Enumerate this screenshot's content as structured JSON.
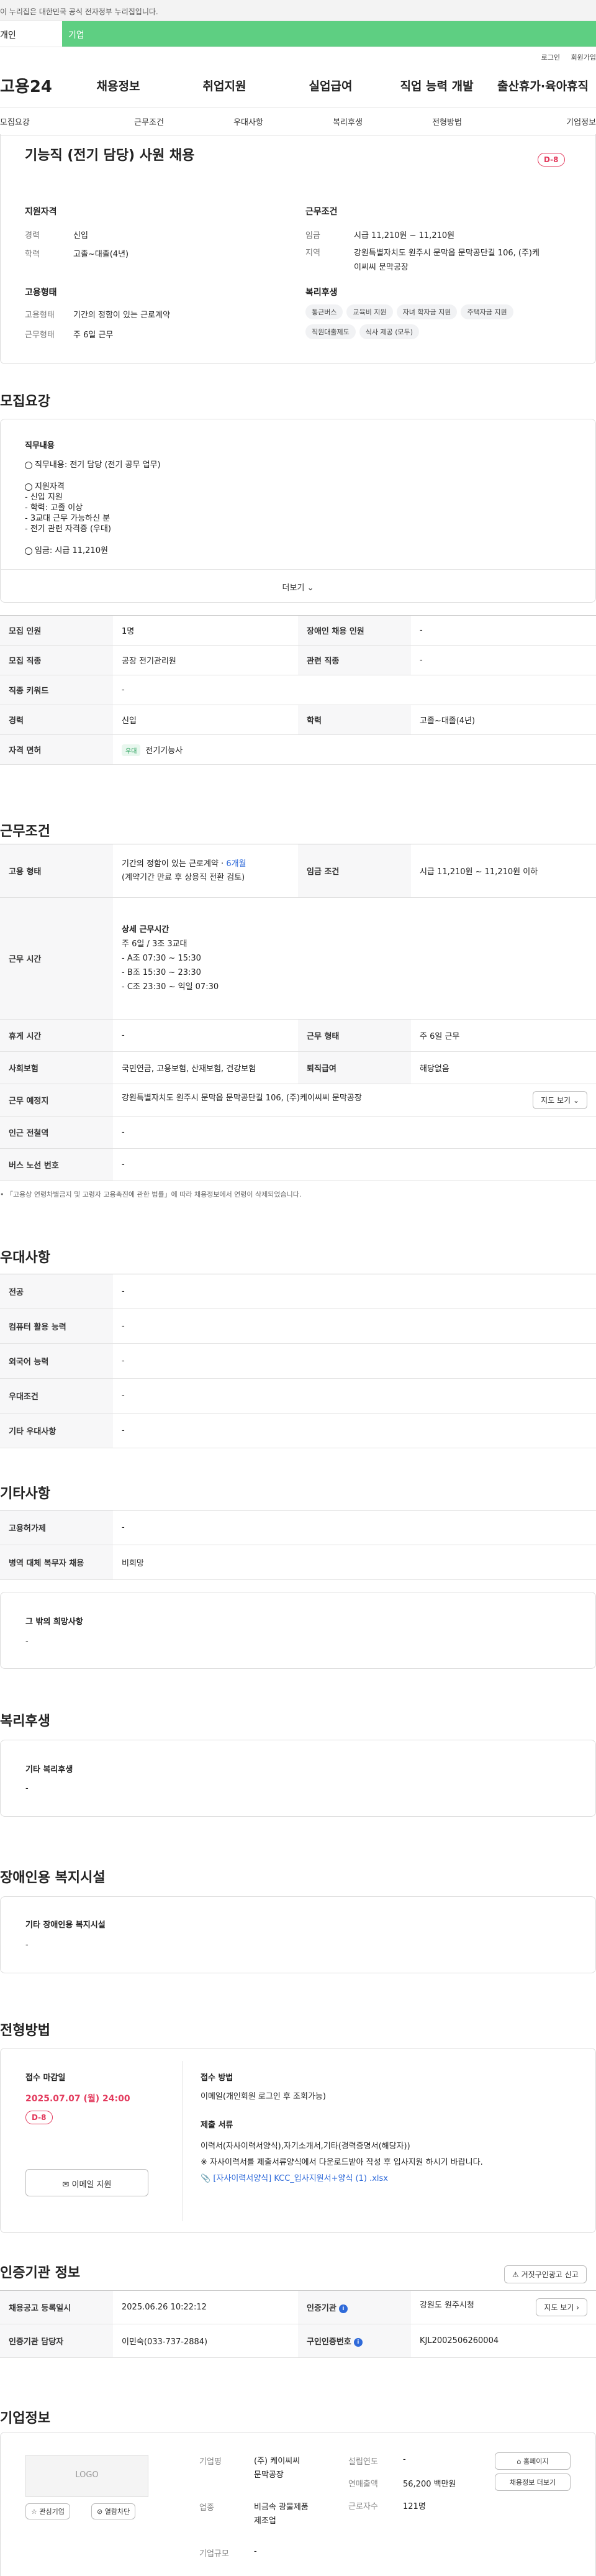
{
  "gov_notice": "이 누리집은 대한민국 공식 전자정부 누리집입니다.",
  "top_tabs": {
    "personal": "개인",
    "company": "기업"
  },
  "utility": {
    "login": "로그인",
    "signup": "회원가입"
  },
  "logo": "고용24",
  "main_nav": [
    "채용정보",
    "취업지원",
    "실업급여",
    "직업 능력 개발",
    "출산휴가·육아휴직"
  ],
  "sub_nav": [
    "모집요강",
    "근무조건",
    "우대사항",
    "복리후생",
    "전형방법",
    "기업정보"
  ],
  "header": {
    "title": "기능직 (전기 담당) 사원 채용",
    "dday": "D-8",
    "qualification": {
      "label": "지원자격",
      "career_k": "경력",
      "career_v": "신입",
      "edu_k": "학력",
      "edu_v": "고졸~대졸(4년)"
    },
    "conditions": {
      "label": "근무조건",
      "wage_k": "임금",
      "wage_v": "시급 11,210원 ~ 11,210원",
      "loc_k": "지역",
      "loc_v1": "강원특별자치도 원주시 문막읍 문막공단길 106, (주)케",
      "loc_v2": "이씨씨 문막공장"
    },
    "employment": {
      "label": "고용형태",
      "type_k": "고용형태",
      "type_v": "기간의 정함이 있는 근로계약",
      "work_k": "근무형태",
      "work_v": "주 6일 근무"
    },
    "welfare": {
      "label": "복리후생",
      "chips": [
        "통근버스",
        "교육비 지원",
        "자녀 학자금 지원",
        "주택자금 지원",
        "직원대출제도",
        "식사 제공 (모두)"
      ]
    }
  },
  "recruit": {
    "heading": "모집요강",
    "content_label": "직무내용",
    "line1": "직무내용: 전기 담당 (전기 공무 업무)",
    "line2": "지원자격",
    "line3": "- 신입 지원",
    "line4": "- 학력: 고졸 이상",
    "line5": "- 3교대 근무 가능하신 분",
    "line6": "- 전기 관련 자격증 (우대)",
    "line7": "임금: 시급 11,210원",
    "more": "더보기",
    "table": {
      "headcount_k": "모집 인원",
      "headcount_v": "1명",
      "disabled_k": "장애인 채용 인원",
      "disabled_v": "-",
      "job_k": "모집 직종",
      "job_v": "공장 전기관리원",
      "related_k": "관련 직종",
      "related_v": "-",
      "keyword_k": "직종 키워드",
      "keyword_v": "-",
      "career_k": "경력",
      "career_v": "신입",
      "edu_k": "학력",
      "edu_v": "고졸~대졸(4년)",
      "license_k": "자격 면허",
      "license_tag": "우대",
      "license_v": "전기기능사"
    }
  },
  "work": {
    "heading": "근무조건",
    "type_k": "고용 형태",
    "type_v1": "기간의 정함이 있는 근로계약 · ",
    "type_months": "6개월",
    "type_v2": "(계약기간 만료 후 상용직 전환 검토)",
    "wage_k": "임금 조건",
    "wage_v": "시급 11,210원 ~ 11,210원 이하",
    "hours_k": "근무 시간",
    "hours_title": "상세 근무시간",
    "hours": [
      "주 6일 / 3조 3교대",
      "- A조 07:30 ~ 15:30",
      "- B조 15:30 ~ 23:30",
      "- C조 23:30 ~ 익일 07:30"
    ],
    "rest_k": "휴게 시간",
    "rest_v": "-",
    "form_k": "근무 형태",
    "form_v": "주 6일 근무",
    "insurance_k": "사회보험",
    "insurance_v": "국민연금, 고용보험, 산재보험, 건강보험",
    "retire_k": "퇴직급여",
    "retire_v": "해당없음",
    "place_k": "근무 예정지",
    "place_v": "강원특별자치도 원주시 문막읍 문막공단길 106, (주)케이씨씨 문막공장",
    "map_btn": "지도 보기",
    "subway_k": "인근 전철역",
    "subway_v": "-",
    "bus_k": "버스 노선 번호",
    "bus_v": "-",
    "note": "「고용상 연령차별금지 및 고령자 고용촉진에 관한 법률」에 따라 채용정보에서 연령이 삭제되었습니다."
  },
  "pref": {
    "heading": "우대사항",
    "rows": [
      [
        "전공",
        "-"
      ],
      [
        "컴퓨터 활용 능력",
        "-"
      ],
      [
        "외국어 능력",
        "-"
      ],
      [
        "우대조건",
        "-"
      ],
      [
        "기타 우대사항",
        "-"
      ]
    ]
  },
  "etc": {
    "heading": "기타사항",
    "rows": [
      [
        "고용허가제",
        "-"
      ],
      [
        "병역 대체 복무자 채용",
        "비희망"
      ]
    ],
    "wish_label": "그 밖의 희망사항",
    "wish_v": "-"
  },
  "welfare": {
    "heading": "복리후생",
    "label": "기타 복리후생",
    "value": "-"
  },
  "disabled": {
    "heading": "장애인용 복지시설",
    "label": "기타 장애인용 복지시설",
    "value": "-"
  },
  "selection": {
    "heading": "전형방법",
    "deadline_label": "접수 마감일",
    "deadline": "2025.07.07 (월) 24:00",
    "dday": "D-8",
    "apply_btn": "이메일 지원",
    "method_label": "접수 방법",
    "method_v": "이메일(개인회원 로그인 후 조회가능)",
    "docs_label": "제출 서류",
    "docs_v": "이력서(자사이력서양식),자기소개서,기타(경력증명서(해당자))",
    "docs_note": "※ 자사이력서를 제출서류양식에서 다운로드받아 작성 후 입사지원 하시기 바랍니다.",
    "file": "[자사이력서양식] KCC_입사지원서+양식 (1) .xlsx"
  },
  "cert": {
    "heading": "인증기관 정보",
    "report_btn": "거짓구인광고 신고",
    "reg_k": "채용공고 등록일시",
    "reg_v": "2025.06.26 10:22:12",
    "org_k": "인증기관",
    "org_v": "강원도 원주시청",
    "map_btn": "지도 보기",
    "manager_k": "인증기관 담당자",
    "manager_v": "이민숙(033-737-2884)",
    "id_k": "구인인증번호",
    "id_v": "KJL2002506260004"
  },
  "company": {
    "heading": "기업정보",
    "logo_text": "LOGO",
    "interest_btn": "관심기업",
    "block_btn": "열람차단",
    "name_k": "기업명",
    "name_v1": "(주) 케이씨씨",
    "name_v2": "문막공장",
    "industry_k": "업종",
    "industry_v1": "비금속 광물제품",
    "industry_v2": "제조업",
    "size_k": "기업규모",
    "size_v": "-",
    "founded_k": "설립연도",
    "founded_v": "-",
    "sales_k": "연매출액",
    "sales_v": "56,200 백만원",
    "staff_k": "근로자수",
    "staff_v": "121명",
    "home_btn": "홈페이지",
    "jobs_btn": "채용정보 더보기"
  }
}
